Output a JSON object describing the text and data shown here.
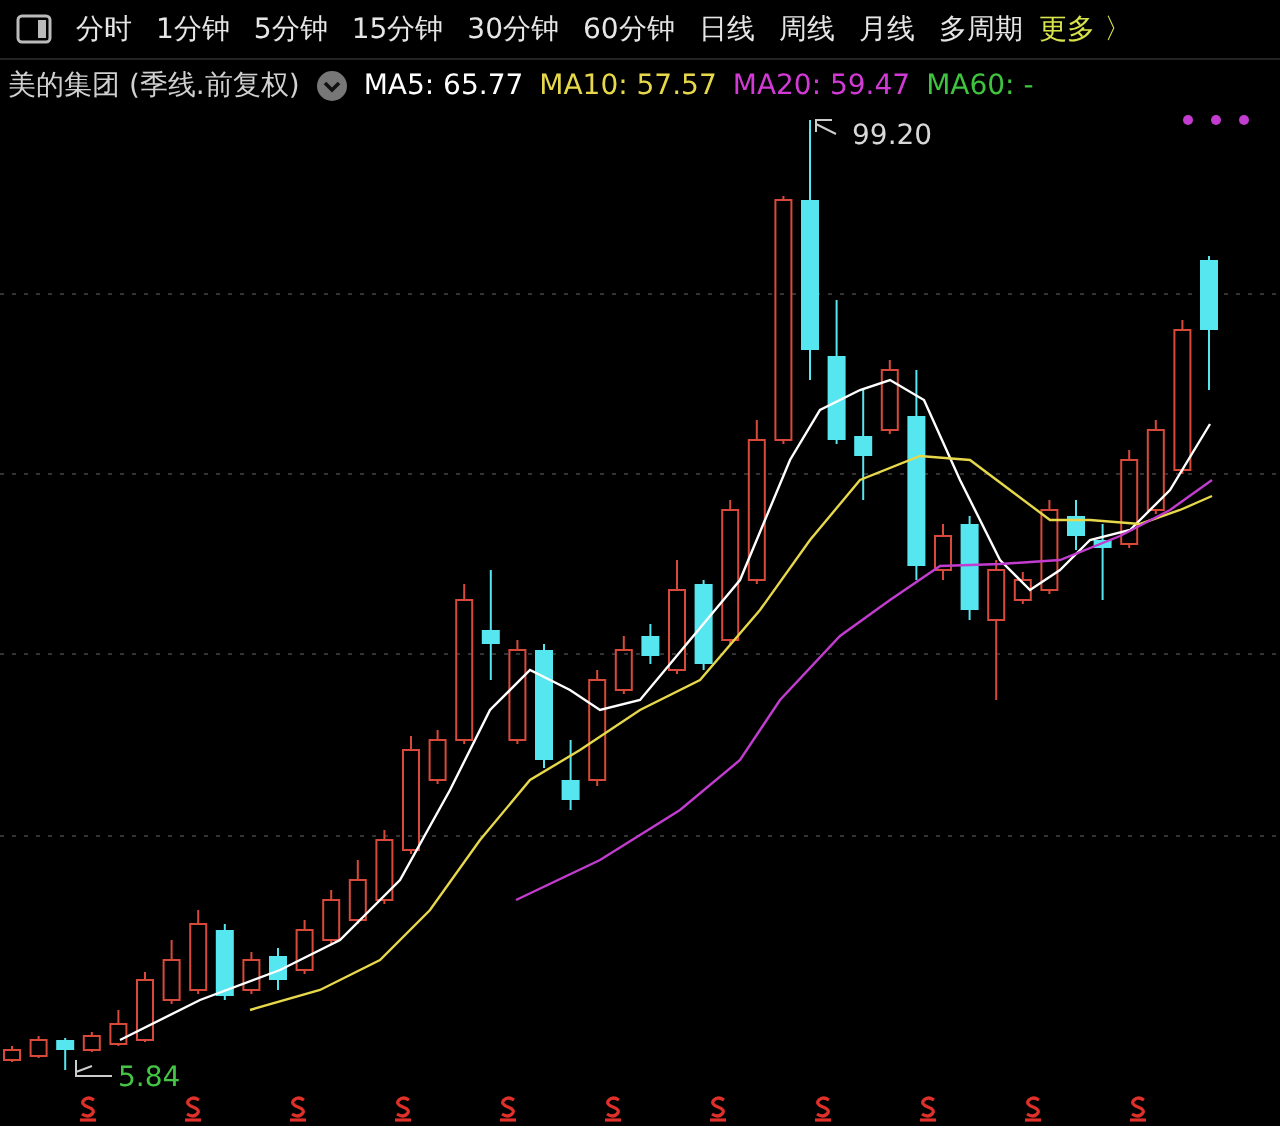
{
  "toolbar": {
    "tabs": [
      {
        "label": "分时",
        "selected": false
      },
      {
        "label": "1分钟",
        "selected": false
      },
      {
        "label": "5分钟",
        "selected": false
      },
      {
        "label": "15分钟",
        "selected": false
      },
      {
        "label": "30分钟",
        "selected": false
      },
      {
        "label": "60分钟",
        "selected": false
      },
      {
        "label": "日线",
        "selected": false
      },
      {
        "label": "周线",
        "selected": false
      },
      {
        "label": "月线",
        "selected": false
      },
      {
        "label": "多周期",
        "selected": false
      }
    ],
    "more": {
      "label": "更多",
      "arrow": "〉"
    }
  },
  "legend": {
    "title": "美的集团 (季线.前复权)",
    "items": [
      {
        "label": "MA5: 65.77",
        "color": "#ffffff"
      },
      {
        "label": "MA10: 57.57",
        "color": "#e6d84a"
      },
      {
        "label": "MA20: 59.47",
        "color": "#d23ad6"
      },
      {
        "label": "MA60: -",
        "color": "#3ec43e"
      }
    ]
  },
  "chart": {
    "high_label": "99.20",
    "low_label": "5.84"
  }
}
